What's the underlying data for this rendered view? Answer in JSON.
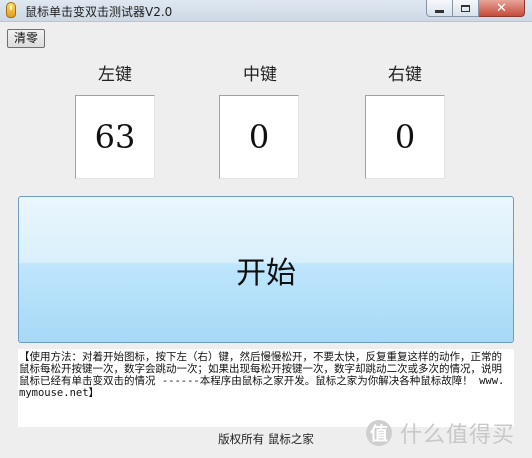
{
  "window": {
    "title": "鼠标单击变双击测试器V2.0",
    "icon": "mouse-icon",
    "minimize_glyph": "",
    "maximize_glyph": "",
    "close_glyph": "✕"
  },
  "toolbar": {
    "clear_label": "清零"
  },
  "counters": [
    {
      "label": "左键",
      "value": "63"
    },
    {
      "label": "中键",
      "value": "0"
    },
    {
      "label": "右键",
      "value": "0"
    }
  ],
  "start_button": {
    "label": "开始"
  },
  "instructions": {
    "text": "【使用方法：对着开始图标，按下左（右）键，然后慢慢松开，不要太快，反复重复这样的动作，正常的鼠标每松开按键一次，数字会跳动一次；如果出现每松开按键一次，数字却跳动二次或多次的情况，说明鼠标已经有单击变双击的情况 ------本程序由鼠标之家开发。鼠标之家为你解决各种鼠标故障！ www.mymouse.net】"
  },
  "footer": {
    "copyright": "版权所有 鼠标之家"
  },
  "watermark": {
    "glyph": "值",
    "text": "什么值得买"
  }
}
